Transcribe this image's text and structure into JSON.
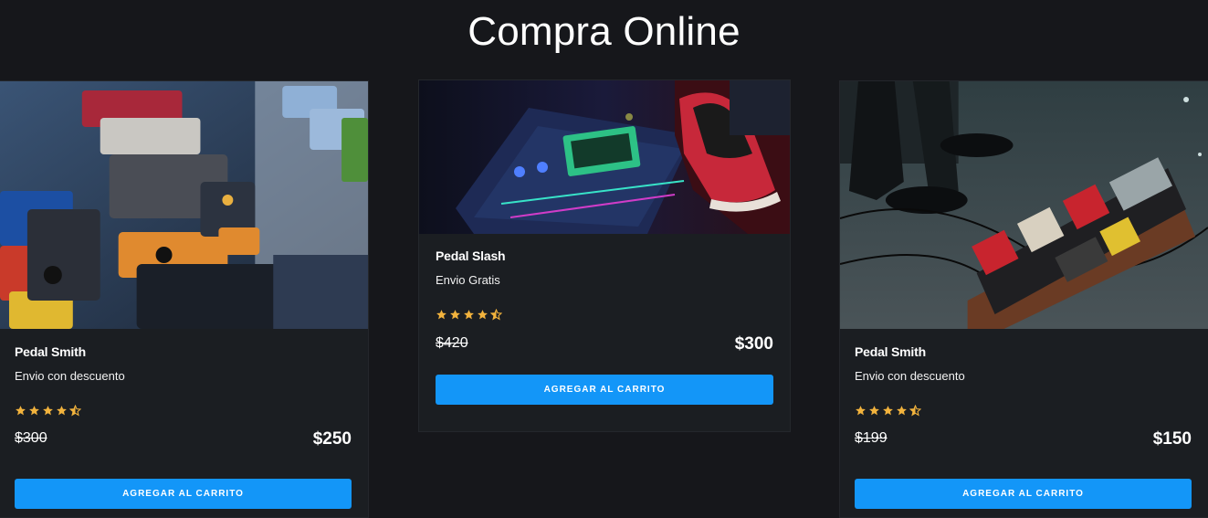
{
  "page": {
    "title": "Compra Online"
  },
  "colors": {
    "background": "#16171b",
    "card": "#1b1e22",
    "accent_button": "#1396f8",
    "star": "#f2b33d",
    "text": "#ffffff"
  },
  "products": [
    {
      "name": "Pedal Smith",
      "shipping": "Envio con descuento",
      "rating": 4.5,
      "old_price": "$300",
      "price": "$250",
      "button_label": "AGREGAR AL CARRITO",
      "image": "guitar-pedals-closeup-photo"
    },
    {
      "name": "Pedal Slash",
      "shipping": "Envio Gratis",
      "rating": 4.5,
      "old_price": "$420",
      "price": "$300",
      "button_label": "AGREGAR AL CARRITO",
      "image": "headrush-multi-effects-pedal-photo"
    },
    {
      "name": "Pedal Smith",
      "shipping": "Envio con descuento",
      "rating": 4.5,
      "old_price": "$199",
      "price": "$150",
      "button_label": "AGREGAR AL CARRITO",
      "image": "pedalboard-on-floor-photo"
    }
  ]
}
